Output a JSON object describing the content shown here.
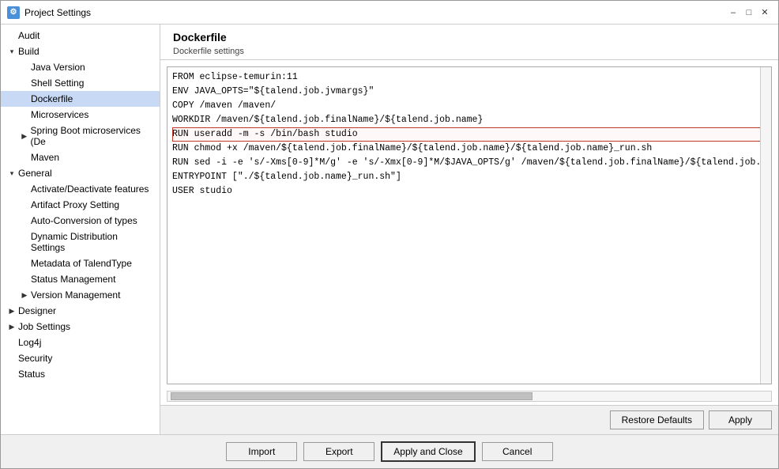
{
  "window": {
    "title": "Project Settings",
    "icon": "P"
  },
  "sidebar": {
    "items": [
      {
        "id": "audit",
        "label": "Audit",
        "level": 0,
        "expandable": false,
        "selected": false
      },
      {
        "id": "build",
        "label": "Build",
        "level": 0,
        "expandable": true,
        "expanded": true,
        "selected": false
      },
      {
        "id": "java-version",
        "label": "Java Version",
        "level": 1,
        "expandable": false,
        "selected": false
      },
      {
        "id": "shell-setting",
        "label": "Shell Setting",
        "level": 1,
        "expandable": false,
        "selected": false
      },
      {
        "id": "dockerfile",
        "label": "Dockerfile",
        "level": 1,
        "expandable": false,
        "selected": true
      },
      {
        "id": "microservices",
        "label": "Microservices",
        "level": 1,
        "expandable": false,
        "selected": false
      },
      {
        "id": "spring-boot",
        "label": "Spring Boot microservices (De",
        "level": 1,
        "expandable": true,
        "selected": false
      },
      {
        "id": "maven",
        "label": "Maven",
        "level": 1,
        "expandable": false,
        "selected": false
      },
      {
        "id": "general",
        "label": "General",
        "level": 0,
        "expandable": true,
        "expanded": true,
        "selected": false
      },
      {
        "id": "activate",
        "label": "Activate/Deactivate features",
        "level": 1,
        "expandable": false,
        "selected": false
      },
      {
        "id": "artifact-proxy",
        "label": "Artifact Proxy Setting",
        "level": 1,
        "expandable": false,
        "selected": false
      },
      {
        "id": "auto-conversion",
        "label": "Auto-Conversion of types",
        "level": 1,
        "expandable": false,
        "selected": false
      },
      {
        "id": "dynamic-dist",
        "label": "Dynamic Distribution Settings",
        "level": 1,
        "expandable": false,
        "selected": false
      },
      {
        "id": "metadata",
        "label": "Metadata of TalendType",
        "level": 1,
        "expandable": false,
        "selected": false
      },
      {
        "id": "status-mgmt",
        "label": "Status Management",
        "level": 1,
        "expandable": false,
        "selected": false
      },
      {
        "id": "version-mgmt",
        "label": "Version Management",
        "level": 1,
        "expandable": true,
        "selected": false
      },
      {
        "id": "designer",
        "label": "Designer",
        "level": 0,
        "expandable": true,
        "expanded": false,
        "selected": false
      },
      {
        "id": "job-settings",
        "label": "Job Settings",
        "level": 0,
        "expandable": true,
        "expanded": false,
        "selected": false
      },
      {
        "id": "log4j",
        "label": "Log4j",
        "level": 0,
        "expandable": false,
        "selected": false
      },
      {
        "id": "security",
        "label": "Security",
        "level": 0,
        "expandable": false,
        "selected": false
      },
      {
        "id": "status",
        "label": "Status",
        "level": 0,
        "expandable": false,
        "selected": false
      }
    ]
  },
  "content": {
    "title": "Dockerfile",
    "subtitle": "Dockerfile settings",
    "lines": [
      {
        "id": 1,
        "text": "FROM eclipse-temurin:11",
        "highlighted": false
      },
      {
        "id": 2,
        "text": "ENV JAVA_OPTS=\"${talend.job.jvmargs}\"",
        "highlighted": false
      },
      {
        "id": 3,
        "text": "COPY /maven /maven/",
        "highlighted": false
      },
      {
        "id": 4,
        "text": "WORKDIR /maven/${talend.job.finalName}/${talend.job.name}",
        "highlighted": false
      },
      {
        "id": 5,
        "text": "RUN useradd -m -s /bin/bash studio",
        "highlighted": true
      },
      {
        "id": 6,
        "text": "RUN chmod +x /maven/${talend.job.finalName}/${talend.job.name}/${talend.job.name}_run.sh",
        "highlighted": false
      },
      {
        "id": 7,
        "text": "RUN sed -i -e 's/-Xms[0-9]*M/g' -e 's/-Xmx[0-9]*M/$JAVA_OPTS/g' /maven/${talend.job.finalName}/${talend.job.name}/${talend.job.name",
        "highlighted": false
      },
      {
        "id": 8,
        "text": "ENTRYPOINT [\"./${talend.job.name}_run.sh\"]",
        "highlighted": false
      },
      {
        "id": 9,
        "text": "USER studio",
        "highlighted": false
      }
    ]
  },
  "buttons": {
    "restore_defaults": "Restore Defaults",
    "apply": "Apply",
    "import": "Import",
    "export": "Export",
    "apply_close": "Apply and Close",
    "cancel": "Cancel"
  }
}
